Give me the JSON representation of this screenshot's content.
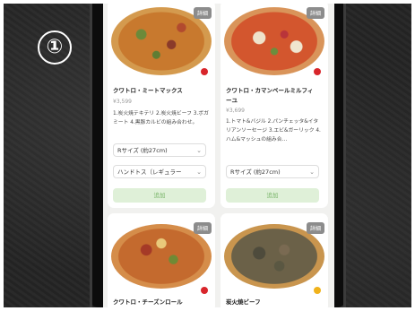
{
  "badge": "①",
  "products": [
    {
      "name": "クワトロ・ミートマックス",
      "price": "¥3,599",
      "description": "1.炭火焼テキテリ 2.炭火焼ビーフ 3.ボガミート 4.黒豚カルビの組み合わせ。",
      "detail_label": "詳細",
      "size_select": "Rサイズ (約27cm)",
      "crust_select": "ハンドトス（レギュラー",
      "add_label": "追加",
      "logo_color": "#d8252b"
    },
    {
      "name": "クワトロ・カマンベールミルフィーユ",
      "price": "¥3,699",
      "description": "1.トマト&バジル 2.パンチェッタ&イタリアンソーセージ 3.エビ&ガーリック 4.ハム&マッシュの組み合…",
      "detail_label": "詳細",
      "size_select": "Rサイズ (約27cm)",
      "add_label": "追加",
      "logo_color": "#d8252b"
    },
    {
      "name": "クワトロ・チーズンロール",
      "detail_label": "詳細",
      "logo_color": "#d8252b"
    },
    {
      "name": "炭火焼ビーフ",
      "detail_label": "詳細",
      "logo_color": "#f0b21b"
    }
  ],
  "icons": {
    "chevron": "chevron-down-icon"
  }
}
